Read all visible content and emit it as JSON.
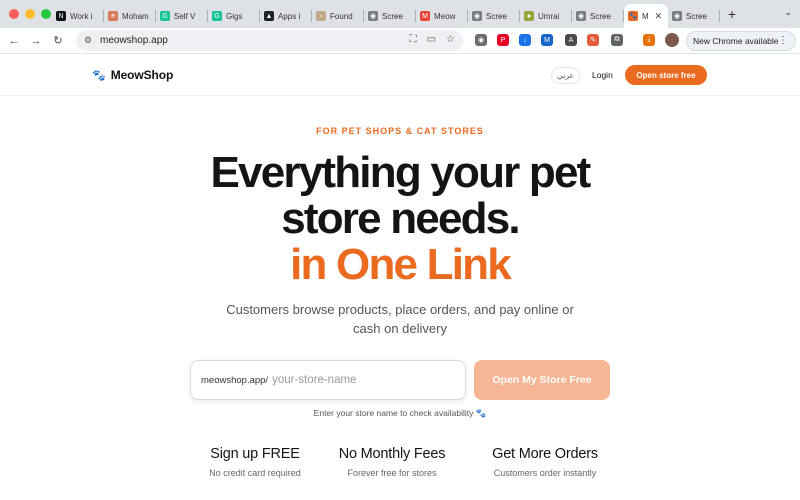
{
  "browser": {
    "traffic_colors": [
      "#ff5f57",
      "#febc2e",
      "#28c840"
    ],
    "tabs": [
      {
        "title": "Work i",
        "icon": "notion-icon",
        "icon_color": "#111111",
        "icon_char": "N"
      },
      {
        "title": "Moham",
        "icon": "claude-icon",
        "icon_color": "#d97757",
        "icon_char": "✳"
      },
      {
        "title": "Self V",
        "icon": "grammarly-icon",
        "icon_color": "#15c39a",
        "icon_char": "G"
      },
      {
        "title": "Gigs",
        "icon": "grammarly-icon",
        "icon_color": "#15c39a",
        "icon_char": "G"
      },
      {
        "title": "Apps i",
        "icon": "framer-icon",
        "icon_color": "#222222",
        "icon_char": "▲"
      },
      {
        "title": "Found",
        "icon": "document-icon",
        "icon_color": "#c4a88a",
        "icon_char": "▫"
      },
      {
        "title": "Scree",
        "icon": "camera-icon",
        "icon_color": "#7a7a7a",
        "icon_char": "◉"
      },
      {
        "title": "Meow",
        "icon": "gmail-icon",
        "icon_color": "#ea4335",
        "icon_char": "M"
      },
      {
        "title": "Scree",
        "icon": "camera-icon",
        "icon_color": "#7a7a7a",
        "icon_char": "◉"
      },
      {
        "title": "Umrai",
        "icon": "site-icon",
        "icon_color": "#9aa33a",
        "icon_char": "●"
      },
      {
        "title": "Scree",
        "icon": "camera-icon",
        "icon_color": "#7a7a7a",
        "icon_char": "◉"
      },
      {
        "title": "M",
        "icon": "meowshop-icon",
        "icon_color": "#ea6a1f",
        "icon_char": "🐾",
        "active": true
      },
      {
        "title": "Scree",
        "icon": "camera-icon",
        "icon_color": "#7a7a7a",
        "icon_char": "◉"
      }
    ],
    "new_tab": "+",
    "url": "meowshop.app",
    "update_label": "New Chrome available",
    "extensions": [
      {
        "icon": "camera-ext-icon",
        "color": "#6b6b6b",
        "char": "◉"
      },
      {
        "icon": "pinterest-icon",
        "color": "#e60023",
        "char": "P"
      },
      {
        "icon": "download-ext-icon",
        "color": "#1a73e8",
        "char": "↓"
      },
      {
        "icon": "mark-ext-icon",
        "color": "#1463c6",
        "char": "M"
      },
      {
        "icon": "translate-ext-icon",
        "color": "#4a4a4a",
        "char": "A"
      },
      {
        "icon": "pencil-ext-icon",
        "color": "#e25b3b",
        "char": "✎"
      },
      {
        "icon": "puzzle-icon",
        "color": "#5f6368",
        "char": "⧉"
      },
      {
        "icon": "download-icon",
        "color": "#e8710a",
        "char": "⤓"
      }
    ]
  },
  "site": {
    "brand": "MeowShop",
    "lang": "عربي",
    "login": "Login",
    "cta": "Open store free",
    "accent": "#ea6a1f"
  },
  "hero": {
    "eyebrow": "FOR PET SHOPS & CAT STORES",
    "headline_line1": "Everything your pet",
    "headline_line2": "store needs.",
    "headline_line3": "in One Link",
    "subtitle_line1": "Customers browse products, place orders, and pay online or",
    "subtitle_line2": "cash on delivery",
    "input_prefix": "meowshop.app/",
    "input_placeholder": "your-store-name",
    "submit_label": "Open My Store Free",
    "hint": "Enter your store name to check availability 🐾"
  },
  "features": [
    {
      "title": "Sign up FREE",
      "subtitle": "No credit card required"
    },
    {
      "title": "No Monthly Fees",
      "subtitle": "Forever free for stores"
    },
    {
      "title": "Get More Orders",
      "subtitle": "Customers order instantly"
    }
  ]
}
